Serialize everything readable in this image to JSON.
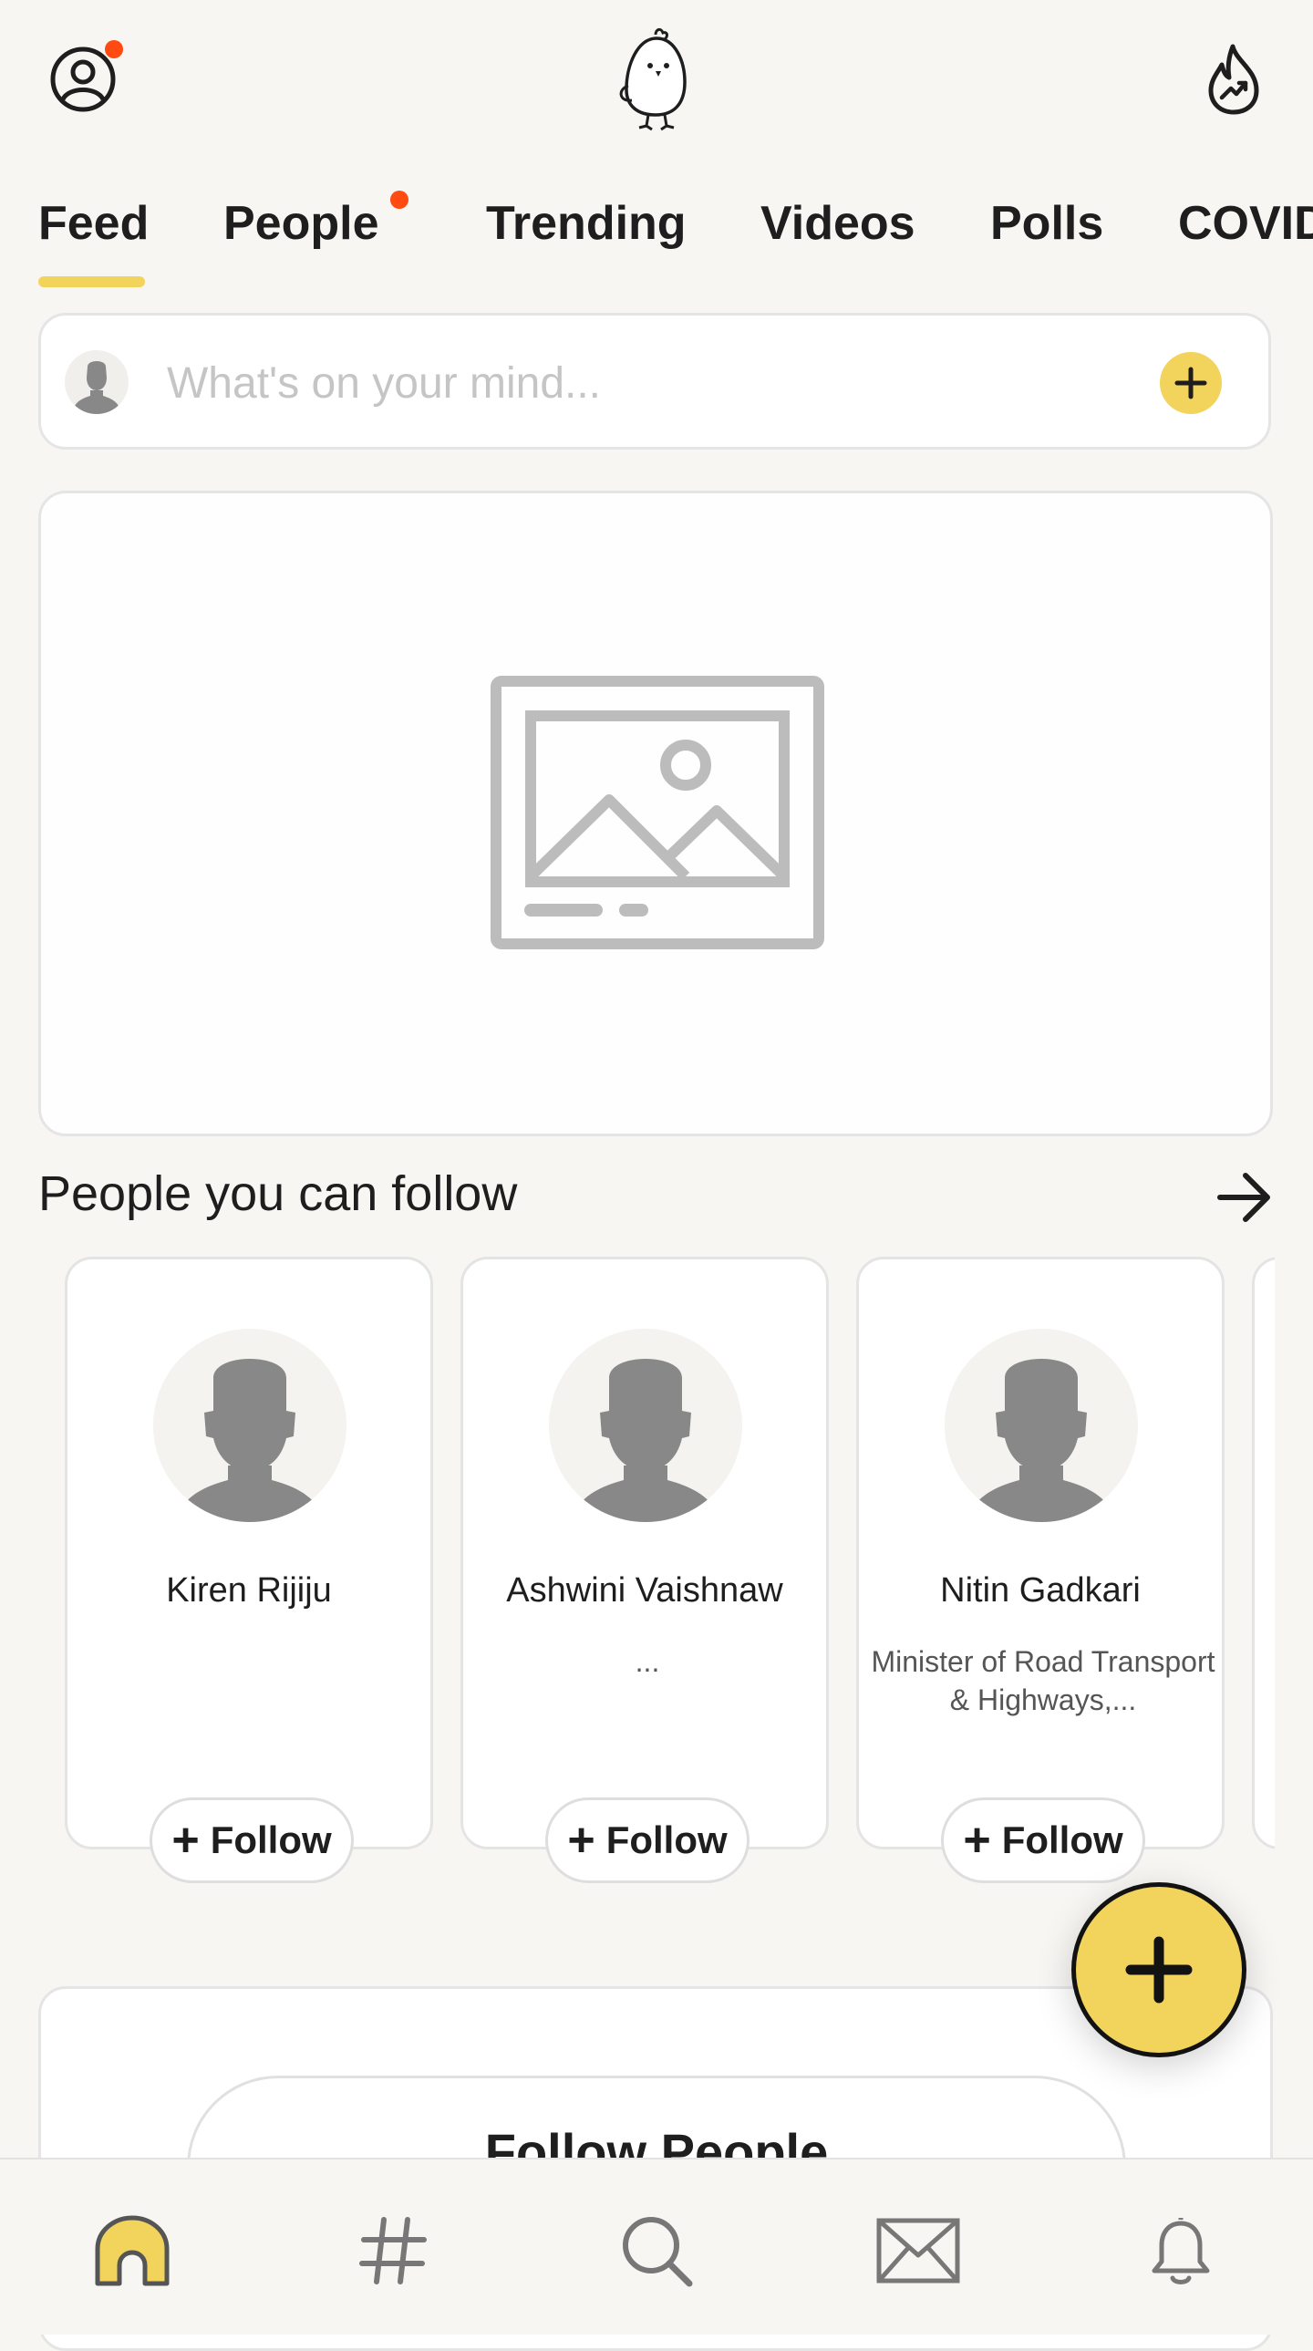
{
  "tabs": [
    {
      "label": "Feed",
      "active": true
    },
    {
      "label": "People",
      "has_notification": true
    },
    {
      "label": "Trending"
    },
    {
      "label": "Videos"
    },
    {
      "label": "Polls"
    },
    {
      "label": "COVID"
    }
  ],
  "composer": {
    "placeholder": "What's on your mind...",
    "add_icon": "plus-icon"
  },
  "section": {
    "title": "People you can follow"
  },
  "people": [
    {
      "name": "Kiren Rijiju",
      "bio": "",
      "follow_label": "Follow"
    },
    {
      "name": "Ashwini Vaishnaw",
      "bio": "...",
      "follow_label": "Follow"
    },
    {
      "name": "Nitin Gadkari",
      "bio": "Minister of Road Transport & Highways,...",
      "follow_label": "Follow"
    }
  ],
  "bottom_card": {
    "button_label": "Follow People"
  },
  "bottom_nav": [
    {
      "icon": "home-icon",
      "active": true
    },
    {
      "icon": "hashtag-icon"
    },
    {
      "icon": "search-icon"
    },
    {
      "icon": "mail-icon"
    },
    {
      "icon": "bell-icon"
    }
  ],
  "colors": {
    "accent": "#f2d35c",
    "notification": "#ff4a12",
    "background": "#f7f6f3"
  }
}
